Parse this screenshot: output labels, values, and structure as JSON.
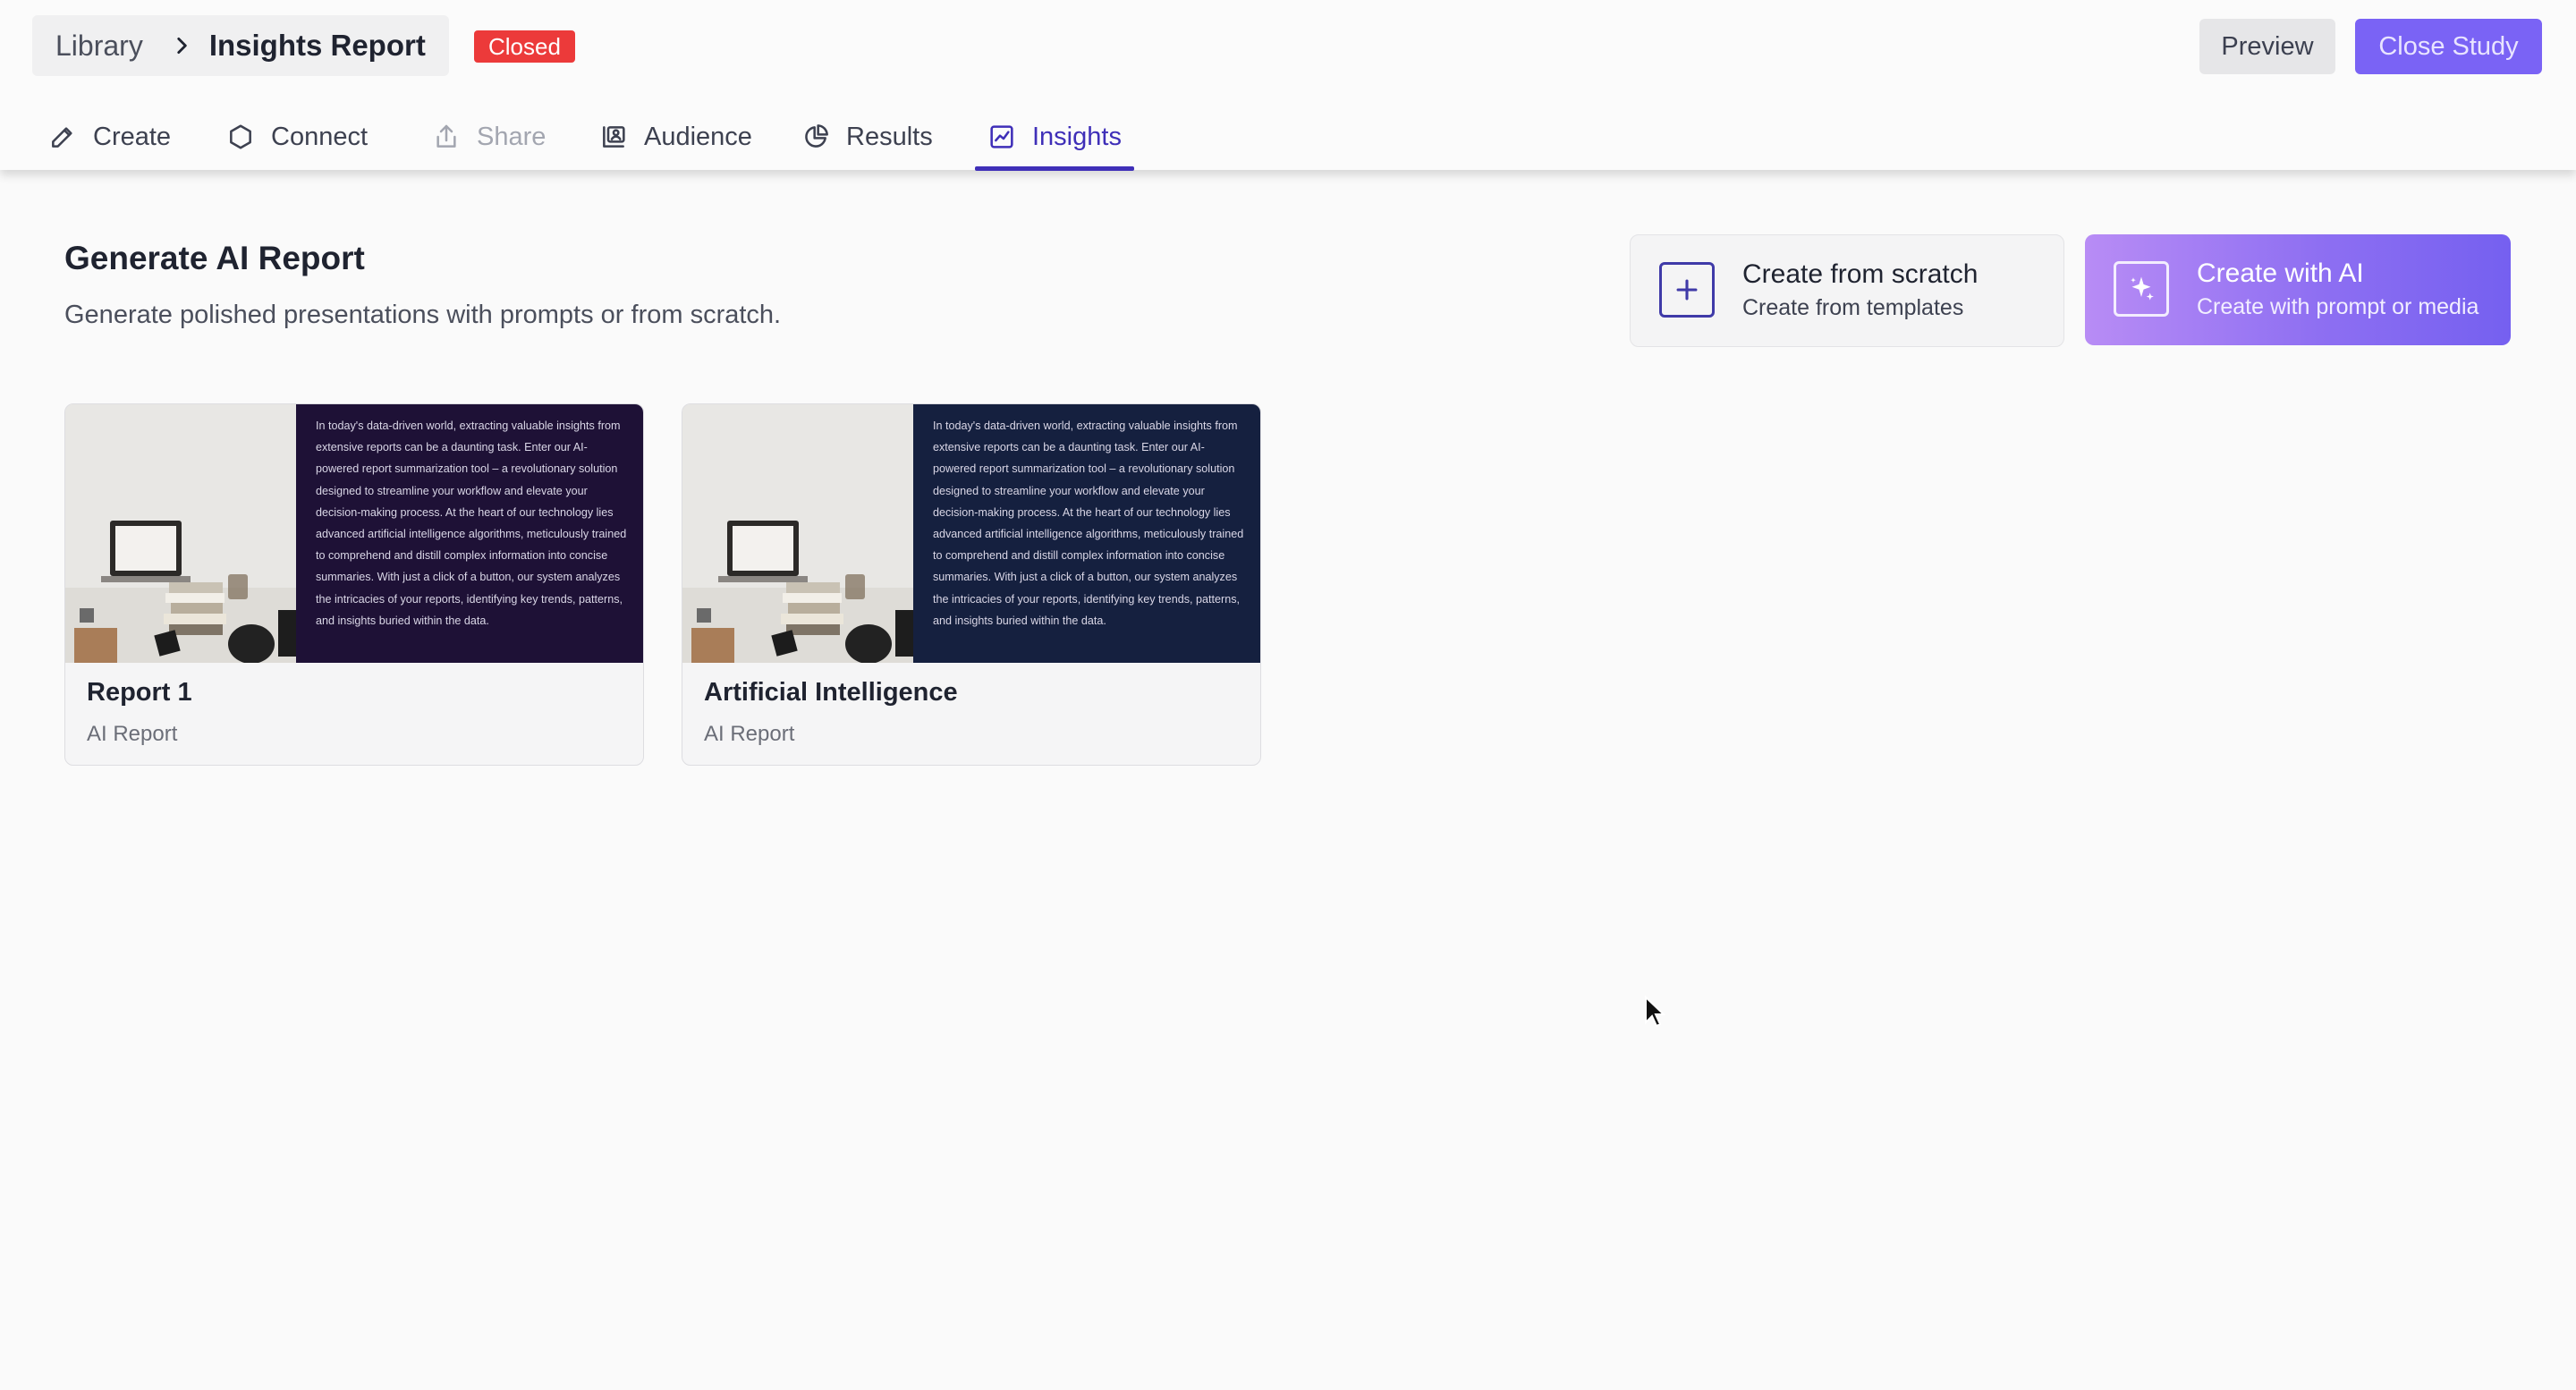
{
  "header": {
    "breadcrumb": {
      "root": "Library",
      "current": "Insights Report"
    },
    "status_badge": "Closed",
    "preview_label": "Preview",
    "close_study_label": "Close Study"
  },
  "tabs": [
    {
      "label": "Create",
      "icon": "pencil-icon",
      "state": "normal"
    },
    {
      "label": "Connect",
      "icon": "hexagon-icon",
      "state": "normal"
    },
    {
      "label": "Share",
      "icon": "share-icon",
      "state": "disabled"
    },
    {
      "label": "Audience",
      "icon": "audience-icon",
      "state": "normal"
    },
    {
      "label": "Results",
      "icon": "pie-chart-icon",
      "state": "normal"
    },
    {
      "label": "Insights",
      "icon": "trend-chart-icon",
      "state": "active"
    }
  ],
  "main": {
    "title": "Generate AI Report",
    "subtitle": "Generate polished presentations with prompts or from scratch.",
    "actions": {
      "scratch": {
        "title": "Create from scratch",
        "subtitle": "Create from templates",
        "icon": "plus-icon"
      },
      "ai": {
        "title": "Create with AI",
        "subtitle": "Create with prompt or media",
        "icon": "sparkle-icon"
      }
    },
    "reports": [
      {
        "title": "Report 1",
        "subtitle": "AI Report",
        "thumbnail_bg": "#1e1136",
        "thumbnail_text": "In today's data-driven world, extracting valuable insights from extensive reports can be a daunting task. Enter our AI-powered report summarization tool – a revolutionary solution designed to streamline your workflow and elevate your decision-making process. At the heart of our technology lies advanced artificial intelligence algorithms, meticulously trained to comprehend and distill complex information into concise summaries. With just a click of a button, our system analyzes the intricacies of your reports, identifying key trends, patterns, and insights buried within the data."
      },
      {
        "title": "Artificial Intelligence",
        "subtitle": "AI Report",
        "thumbnail_bg": "#15203f",
        "thumbnail_text": "In today's data-driven world, extracting valuable insights from extensive reports can be a daunting task. Enter our AI-powered report summarization tool – a revolutionary solution designed to streamline your workflow and elevate your decision-making process. At the heart of our technology lies advanced artificial intelligence algorithms, meticulously trained to comprehend and distill complex information into concise summaries. With just a click of a button, our system analyzes the intricacies of your reports, identifying key trends, patterns, and insights buried within the data."
      }
    ]
  },
  "colors": {
    "accent": "#3f2fb8",
    "close_study_bg": "#7a63f5",
    "badge_bg": "#ec3a3a",
    "ai_gradient_start": "#b88cf5",
    "ai_gradient_end": "#7560f0"
  }
}
